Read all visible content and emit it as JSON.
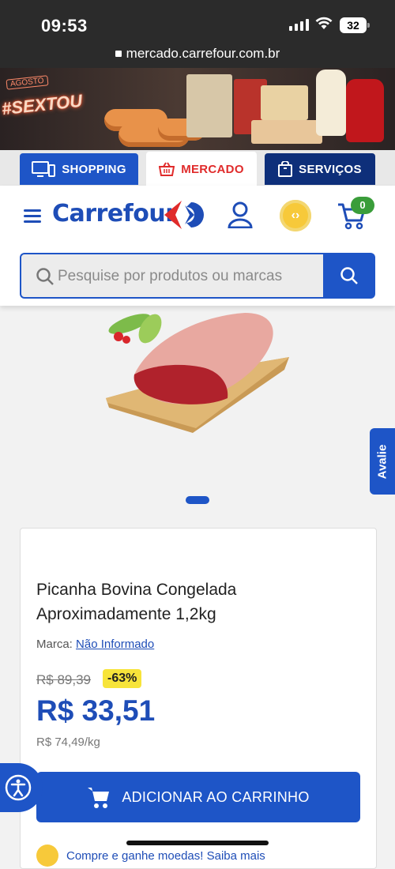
{
  "status_bar": {
    "time": "09:53",
    "battery": "32",
    "url": "mercado.carrefour.com.br"
  },
  "banner": {
    "headline": "#SEXTOU",
    "tag": "AGOSTO"
  },
  "tabs": [
    {
      "label": "SHOPPING",
      "icon": "monitor-icon"
    },
    {
      "label": "MERCADO",
      "icon": "basket-icon"
    },
    {
      "label": "SERVIÇOS",
      "icon": "bag-icon"
    }
  ],
  "header": {
    "logo_text": "Carrefour",
    "cart_count": "0",
    "search_placeholder": "Pesquise por produtos ou marcas"
  },
  "side_tab": {
    "label": "Avalie"
  },
  "product": {
    "title": "Picanha Bovina Congelada Aproximadamente 1,2kg",
    "brand_label": "Marca:",
    "brand_value": "Não Informado",
    "old_price": "R$ 89,39",
    "discount": "-63%",
    "price": "R$ 33,51",
    "unit_price": "R$ 74,49/kg",
    "add_to_cart": "ADICIONAR AO CARRINHO",
    "coins_text": "Compre e ganhe moedas! Saiba mais"
  },
  "colors": {
    "brand_blue": "#1e55c7",
    "brand_red": "#e02b2b",
    "discount_yellow": "#f7e43a"
  }
}
